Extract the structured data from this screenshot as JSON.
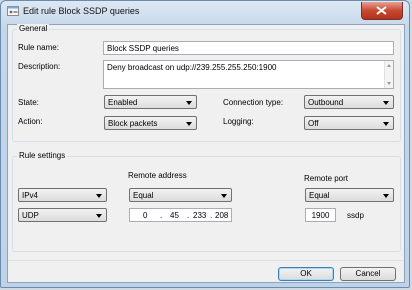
{
  "window": {
    "title": "Edit rule Block SSDP queries"
  },
  "general": {
    "legend": "General",
    "rule_name_label": "Rule name:",
    "rule_name_value": "Block SSDP queries",
    "description_label": "Description:",
    "description_value": "Deny broadcast on udp://239.255.255.250:1900",
    "state_label": "State:",
    "state_value": "Enabled",
    "action_label": "Action:",
    "action_value": "Block packets",
    "connection_type_label": "Connection type:",
    "connection_type_value": "Outbound",
    "logging_label": "Logging:",
    "logging_value": "Off"
  },
  "rule_settings": {
    "legend": "Rule settings",
    "ip_version_value": "IPv4",
    "protocol_value": "UDP",
    "remote_address_label": "Remote address",
    "remote_address_mode_value": "Equal",
    "ip_octets": [
      "0",
      "45",
      "233",
      "208"
    ],
    "remote_port_label": "Remote port",
    "remote_port_mode_value": "Equal",
    "remote_port_value": "1900",
    "remote_port_service": "ssdp"
  },
  "buttons": {
    "ok": "OK",
    "cancel": "Cancel"
  },
  "icons": {
    "title": "settings-window-icon",
    "close": "close-icon"
  }
}
